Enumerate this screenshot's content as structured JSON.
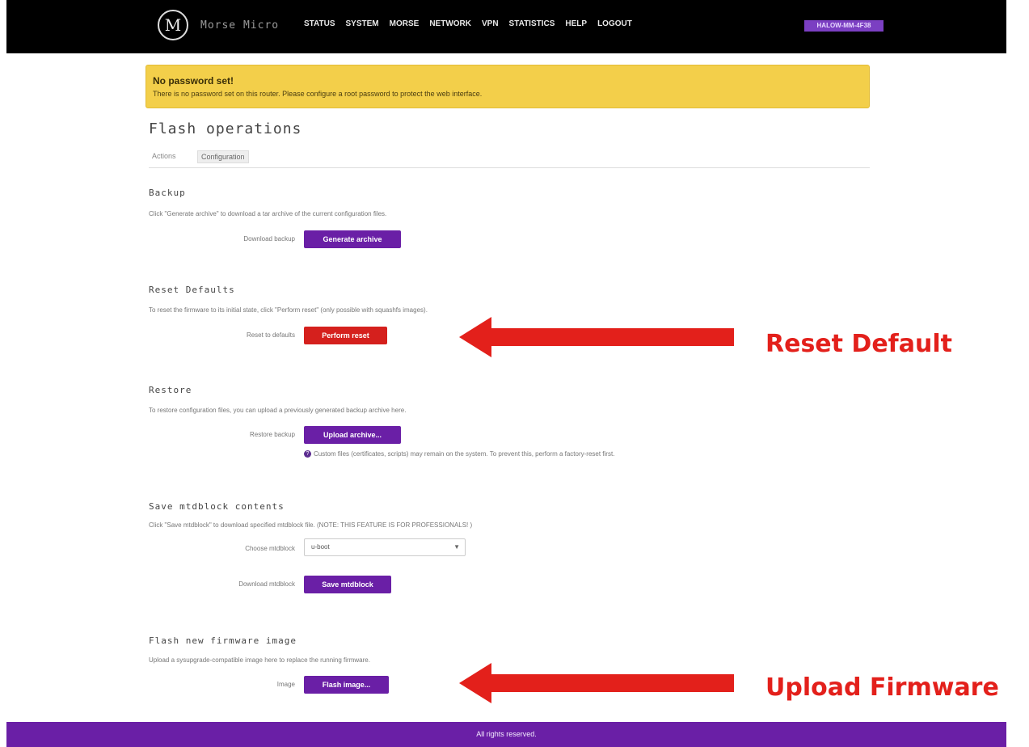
{
  "header": {
    "logo_text": "M",
    "brand": "Morse Micro",
    "nav": [
      "STATUS",
      "SYSTEM",
      "MORSE",
      "NETWORK",
      "VPN",
      "STATISTICS",
      "HELP",
      "LOGOUT"
    ],
    "badge": "HALOW-MM-4F38"
  },
  "alert": {
    "title": "No password set!",
    "text": "There is no password set on this router. Please configure a root password to protect the web interface."
  },
  "page": {
    "title": "Flash operations",
    "tabs": [
      "Actions",
      "Configuration"
    ]
  },
  "backup": {
    "title": "Backup",
    "desc": "Click \"Generate archive\" to download a tar archive of the current configuration files.",
    "label": "Download backup",
    "button": "Generate archive"
  },
  "reset": {
    "title": "Reset Defaults",
    "desc": "To reset the firmware to its initial state, click \"Perform reset\" (only possible with squashfs images).",
    "label": "Reset to defaults",
    "button": "Perform reset"
  },
  "restore": {
    "title": "Restore",
    "desc": "To restore configuration files, you can upload a previously generated backup archive here.",
    "label": "Restore backup",
    "button": "Upload archive...",
    "note_icon": "?",
    "note": "Custom files (certificates, scripts) may remain on the system. To prevent this, perform a factory-reset first."
  },
  "mtd": {
    "title": "Save mtdblock contents",
    "desc": "Click \"Save mtdblock\" to download specified mtdblock file. (NOTE: THIS FEATURE IS FOR PROFESSIONALS! )",
    "choose_label": "Choose mtdblock",
    "choose_value": "u-boot",
    "download_label": "Download mtdblock",
    "button": "Save mtdblock"
  },
  "flash": {
    "title": "Flash new firmware image",
    "desc": "Upload a sysupgrade-compatible image here to replace the running firmware.",
    "label": "Image",
    "button": "Flash image..."
  },
  "annotations": {
    "reset_callout": "Reset Default",
    "upload_callout": "Upload Firmware",
    "color": "#e3201b"
  },
  "footer": {
    "text": "All rights reserved."
  },
  "colors": {
    "accent": "#6a1fa6",
    "danger": "#d5201d",
    "warning": "#f3cf4a"
  }
}
